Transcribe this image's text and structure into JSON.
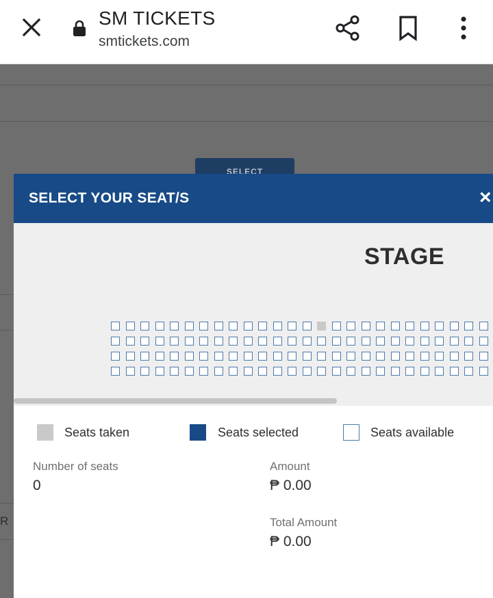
{
  "browser": {
    "title": "SM TICKETS",
    "url": "smtickets.com",
    "icons": [
      "close-icon",
      "lock-icon",
      "share-icon",
      "bookmark-icon",
      "more-vert-icon"
    ]
  },
  "background": {
    "select_button": "SELECT",
    "edge_letter": "R"
  },
  "modal": {
    "title": "SELECT YOUR SEAT/S",
    "close": "×",
    "stage": "STAGE",
    "seat_rows": 4,
    "seats_visible_per_row": 26,
    "taken_seats": [
      {
        "row": 0,
        "col": 14
      }
    ]
  },
  "legend": {
    "taken": "Seats taken",
    "selected": "Seats selected",
    "available": "Seats available"
  },
  "summary": {
    "seats_label": "Number of seats",
    "seats_value": "0",
    "amount_label": "Amount",
    "amount_value": "₱ 0.00",
    "total_label": "Total Amount",
    "total_value": "₱ 0.00"
  },
  "colors": {
    "header_blue": "#174a87",
    "seat_border": "#4b79aa",
    "taken_gray": "#c9c9c9",
    "selected_blue": "#174a87"
  }
}
